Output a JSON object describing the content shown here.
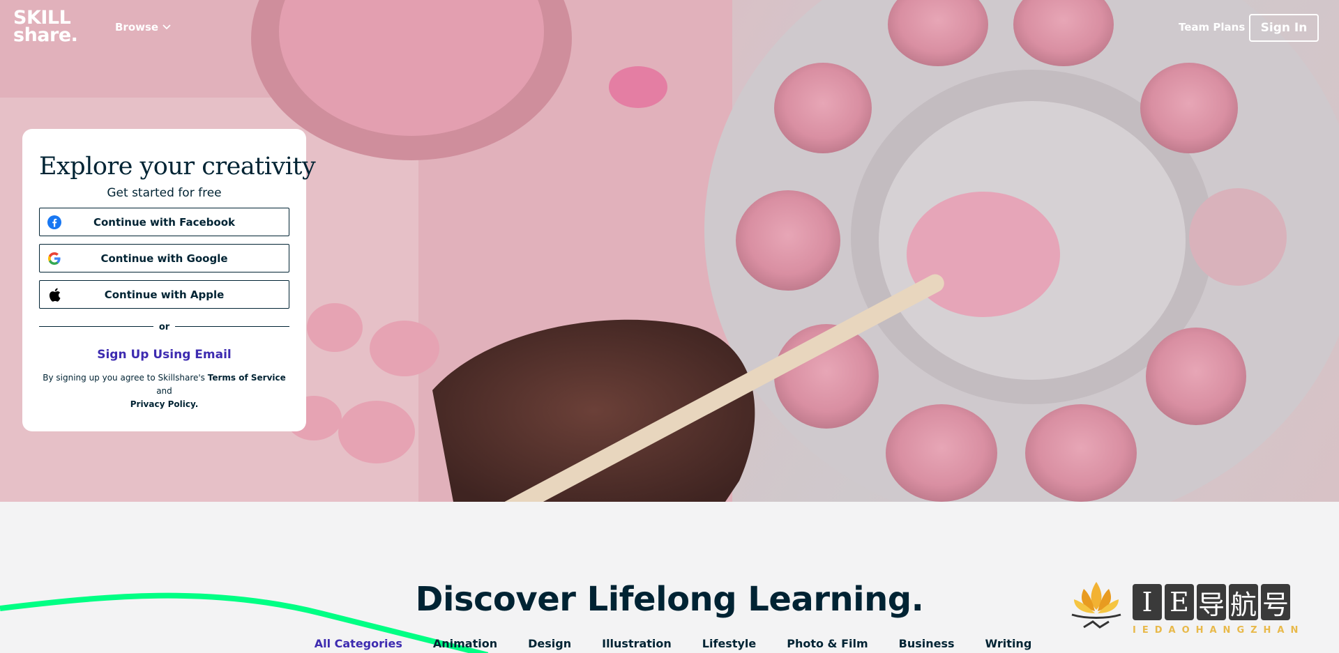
{
  "nav": {
    "logo_line1": "SKILL",
    "logo_line2": "share.",
    "browse_label": "Browse",
    "team_plans_label": "Team Plans",
    "sign_in_label": "Sign In"
  },
  "signup_card": {
    "title": "Explore your creativity",
    "subtitle": "Get started for free",
    "facebook_label": "Continue with Facebook",
    "google_label": "Continue with Google",
    "apple_label": "Continue with Apple",
    "divider_label": "or",
    "email_label": "Sign Up Using Email",
    "terms_prefix": "By signing up you agree to Skillshare's ",
    "terms_link": "Terms of Service",
    "terms_and": " and",
    "privacy_link": "Privacy Policy."
  },
  "discover": {
    "title": "Discover Lifelong Learning.",
    "categories": [
      "All Categories",
      "Animation",
      "Design",
      "Illustration",
      "Lifestyle",
      "Photo & Film",
      "Business",
      "Writing"
    ]
  },
  "watermark": {
    "chars": [
      "I",
      "E",
      "导",
      "航",
      "号"
    ],
    "sub": "IEDAOHANGZHAN"
  },
  "colors": {
    "brand_dark": "#002333",
    "accent_purple": "#3d2bb0",
    "wave_green": "#00ff84"
  }
}
